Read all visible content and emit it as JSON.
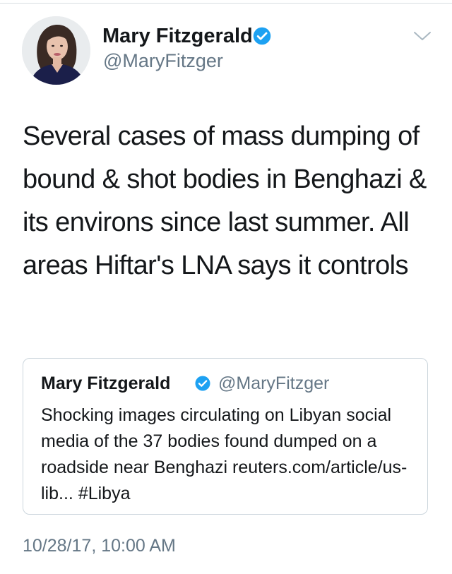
{
  "tweet": {
    "author": {
      "display_name": "Mary Fitzgerald",
      "handle": "@MaryFitzger",
      "verified": true
    },
    "text": "Several cases of mass dumping of bound & shot bodies in Benghazi & its environs since last summer. All areas Hiftar's LNA says it controls",
    "timestamp": "10/28/17, 10:00 AM"
  },
  "quoted_tweet": {
    "author": {
      "display_name": "Mary Fitzgerald",
      "handle": "@MaryFitzger",
      "verified": true
    },
    "text": "Shocking images circulating on Libyan social media of the 37 bodies found dumped on a roadside near Benghazi",
    "link": "reuters.com/article/us-lib...",
    "hashtag": "#Libya"
  },
  "icons": {
    "verified": "verified-badge-icon",
    "menu": "chevron-down-icon"
  },
  "colors": {
    "verified_blue": "#1da1f2",
    "secondary_text": "#657786",
    "border": "#ccd6dd",
    "primary_text": "#14171a"
  }
}
